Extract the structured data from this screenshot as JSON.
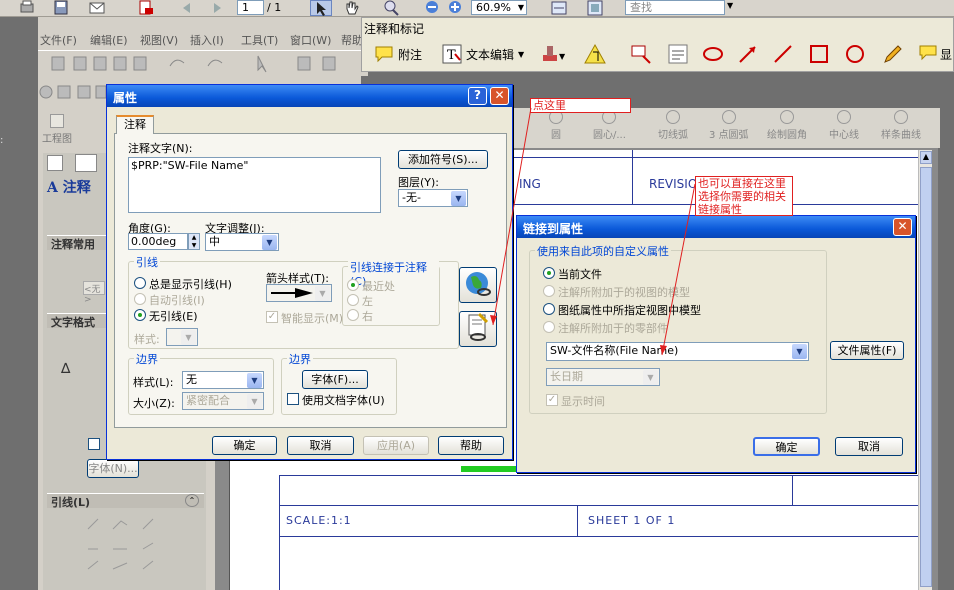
{
  "pdf_toolbar": {
    "page_current": "1",
    "page_total": "/ 1",
    "zoom": "60.9%",
    "search_placeholder": "查找"
  },
  "anno_toolbar": {
    "title": "注释和标记",
    "note_label": "附注",
    "text_edit_label": "文本编辑",
    "show_label": "显"
  },
  "sw": {
    "menu": [
      "文件(F)",
      "编辑(E)",
      "视图(V)",
      "插入(I)",
      "工具(T)",
      "窗口(W)",
      "帮助"
    ],
    "cmd_drawing": "工程图",
    "cmd_items": [
      "圆",
      "圆心/...",
      "切线弧",
      "3 点圆弧",
      "绘制圆角",
      "中心线",
      "样条曲线"
    ],
    "pm_title": "注释",
    "pm_sections": [
      "注释常用",
      "文字格式",
      "引线(L)"
    ],
    "pm_font_button": "字体(N)...",
    "pm_value_box": "<无>"
  },
  "sheet": {
    "text_ing": "ING",
    "text_revision": "REVISIO",
    "scale": "SCALE:1:1",
    "sheet_no": "SHEET 1 OF 1"
  },
  "props_dialog": {
    "title": "属性",
    "tab": "注释",
    "note_text_label": "注释文字(N):",
    "note_text_value": "$PRP:\"SW-File Name\"",
    "add_symbol_btn": "添加符号(S)...",
    "layer_label": "图层(Y):",
    "layer_value": "-无-",
    "angle_label": "角度(G):",
    "angle_value": "0.00deg",
    "text_adjust_label": "文字调整(J):",
    "text_adjust_value": "中",
    "leader_group": "引线",
    "leader_options": [
      "总是显示引线(H)",
      "自动引线(I)",
      "无引线(E)"
    ],
    "leader_style_label": "样式:",
    "arrow_style_label": "箭头样式(T):",
    "smart_display": "智能显示(M)",
    "leader_attach_group": "引线连接于注释(C)",
    "leader_attach_options": [
      "最近处",
      "左",
      "右"
    ],
    "border_group": "边界",
    "border_style_label": "样式(L):",
    "border_style_value": "无",
    "border_size_label": "大小(Z):",
    "border_size_value": "紧密配合",
    "font_group": "边界",
    "font_btn": "字体(F)...",
    "use_doc_font": "使用文档字体(U)",
    "ok": "确定",
    "cancel": "取消",
    "apply": "应用(A)",
    "help": "帮助"
  },
  "link_dialog": {
    "title": "链接到属性",
    "group": "使用来自此项的自定义属性",
    "options": [
      "当前文件",
      "注解所附加于的视图的模型",
      "图纸属性中所指定视图中模型",
      "注解所附加于的零部件"
    ],
    "property_value": "SW-文件名称(File Name)",
    "file_props_btn": "文件属性(F)",
    "date_value": "长日期",
    "show_time": "显示时间",
    "ok": "确定",
    "cancel": "取消"
  },
  "callouts": {
    "click_here": "点这里",
    "select_here": "也可以直接在这里选择你需要的相关链接属性"
  }
}
